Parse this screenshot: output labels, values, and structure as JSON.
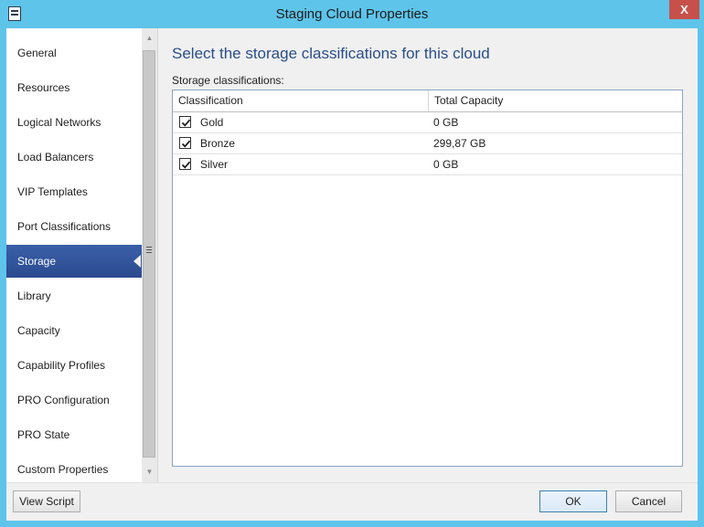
{
  "window": {
    "title": "Staging Cloud Properties",
    "close_glyph": "X"
  },
  "nav": {
    "items": [
      {
        "label": "General"
      },
      {
        "label": "Resources"
      },
      {
        "label": "Logical Networks"
      },
      {
        "label": "Load Balancers"
      },
      {
        "label": "VIP Templates"
      },
      {
        "label": "Port Classifications"
      },
      {
        "label": "Storage",
        "selected": true
      },
      {
        "label": "Library"
      },
      {
        "label": "Capacity"
      },
      {
        "label": "Capability Profiles"
      },
      {
        "label": "PRO Configuration"
      },
      {
        "label": "PRO State"
      },
      {
        "label": "Custom Properties"
      }
    ]
  },
  "main": {
    "heading": "Select the storage classifications for this cloud",
    "list_label": "Storage classifications:",
    "columns": [
      "Classification",
      "Total Capacity"
    ],
    "rows": [
      {
        "checked": true,
        "classification": "Gold",
        "capacity": "0 GB"
      },
      {
        "checked": true,
        "classification": "Bronze",
        "capacity": "299,87 GB"
      },
      {
        "checked": true,
        "classification": "Silver",
        "capacity": "0 GB"
      }
    ]
  },
  "footer": {
    "view_script_label": "View Script",
    "ok_label": "OK",
    "cancel_label": "Cancel"
  },
  "colors": {
    "frame": "#5ec4ea",
    "selection": "#2b4a8f",
    "heading": "#2a4e8a",
    "close": "#c7504a"
  }
}
